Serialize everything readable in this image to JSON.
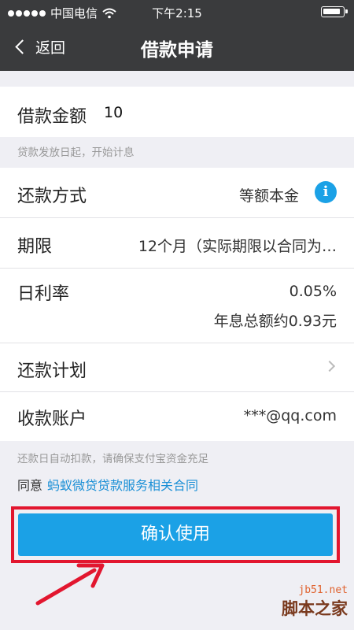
{
  "status_bar": {
    "carrier": "中国电信",
    "time": "下午2:15"
  },
  "nav": {
    "back_label": "返回",
    "title": "借款申请"
  },
  "loan": {
    "amount_label": "借款金额",
    "amount_value": "10",
    "amount_hint": "贷款发放日起，开始计息"
  },
  "details": {
    "repay_method_label": "还款方式",
    "repay_method_value": "等额本金",
    "term_label": "期限",
    "term_value": "12个月（实际期限以合同为…",
    "rate_label": "日利率",
    "rate_value": "0.05%",
    "interest_total": "年息总额约0.93元",
    "plan_label": "还款计划",
    "account_label": "收款账户",
    "account_value": "***@qq.com"
  },
  "footer": {
    "auto_debit_hint": "还款日自动扣款，请确保支付宝资金充足",
    "agree_prefix": "同意",
    "agree_link": "蚂蚁微贷贷款服务相关合同",
    "confirm_label": "确认使用"
  },
  "watermark": {
    "url": "jb51.net",
    "name": "脚本之家"
  },
  "colors": {
    "nav_bg": "#3a3b3d",
    "accent_blue": "#1ba1e6",
    "highlight_red": "#e2162f",
    "link_blue": "#1a8fd6"
  }
}
